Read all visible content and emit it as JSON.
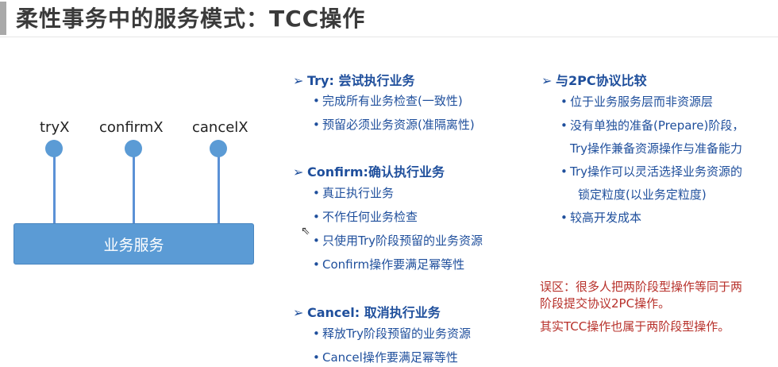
{
  "title": "柔性事务中的服务模式：TCC操作",
  "diagram": {
    "ops": [
      "tryX",
      "confirmX",
      "cancelX"
    ],
    "service": "业务服务"
  },
  "sections": {
    "try": {
      "title": "Try: 尝试执行业务",
      "items": [
        "完成所有业务检查(一致性)",
        "预留必须业务资源(准隔离性)"
      ]
    },
    "confirm": {
      "title": "Confirm:确认执行业务",
      "items": [
        "真正执行业务",
        "不作任何业务检查",
        "只使用Try阶段预留的业务资源",
        "Confirm操作要满足幂等性"
      ]
    },
    "cancel": {
      "title": "Cancel: 取消执行业务",
      "items": [
        "释放Try阶段预留的业务资源",
        "Cancel操作要满足幂等性"
      ]
    },
    "compare": {
      "title": "与2PC协议比较",
      "items": [
        "位于业务服务层而非资源层",
        "没有单独的准备(Prepare)阶段，",
        "Try操作兼备资源操作与准备能力",
        "Try操作可以灵活选择业务资源的",
        "锁定粒度(以业务定粒度)",
        "较高开发成本"
      ]
    }
  },
  "notes": {
    "misconception_line1": "误区：很多人把两阶段型操作等同于两",
    "misconception_line2": "阶段提交协议2PC操作。",
    "fact": "其实TCC操作也属于两阶段型操作。"
  },
  "colors": {
    "accent": "#1f4f9c",
    "box": "#5b9bd5",
    "warning": "#b7302a"
  }
}
